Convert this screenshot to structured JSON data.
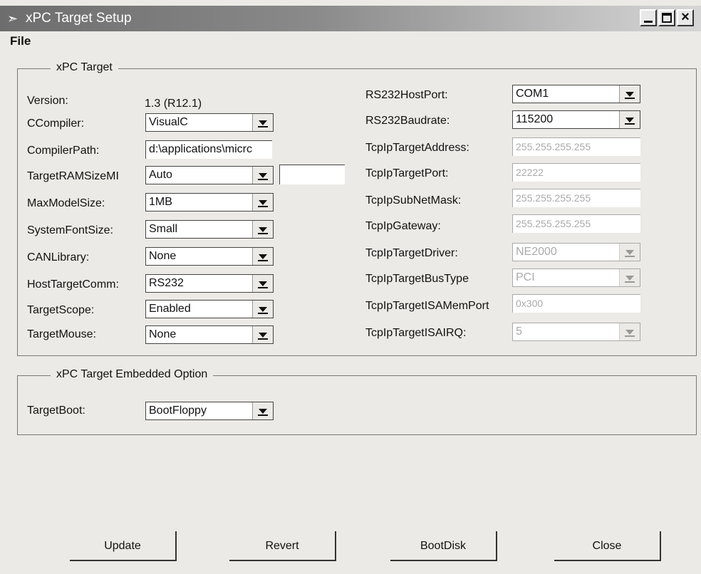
{
  "window": {
    "title": "xPC Target Setup",
    "icon": "matlab-icon"
  },
  "menu": {
    "file": "File"
  },
  "xpc_target": {
    "legend": "xPC Target",
    "version_label": "Version:",
    "version_value": "1.3 (R12.1)",
    "ccompiler_label": "CCompiler:",
    "ccompiler_value": "VisualC",
    "compilerpath_label": "CompilerPath:",
    "compilerpath_value": "d:\\applications\\micrc",
    "ramsize_label": "TargetRAMSizeMI",
    "ramsize_value": "Auto",
    "ramsize_extra_value": "",
    "maxmodelsize_label": "MaxModelSize:",
    "maxmodelsize_value": "1MB",
    "systemfontsize_label": "SystemFontSize:",
    "systemfontsize_value": "Small",
    "canlibrary_label": "CANLibrary:",
    "canlibrary_value": "None",
    "hosttargetcomm_label": "HostTargetComm:",
    "hosttargetcomm_value": "RS232",
    "targetscope_label": "TargetScope:",
    "targetscope_value": "Enabled",
    "targetmouse_label": "TargetMouse:",
    "targetmouse_value": "None",
    "rs232hostport_label": "RS232HostPort:",
    "rs232hostport_value": "COM1",
    "rs232baudrate_label": "RS232Baudrate:",
    "rs232baudrate_value": "115200",
    "tcpip_target_address_label": "TcpIpTargetAddress:",
    "tcpip_target_address_value": "255.255.255.255",
    "tcpip_target_port_label": "TcpIpTargetPort:",
    "tcpip_target_port_value": "22222",
    "tcpip_subnet_mask_label": "TcpIpSubNetMask:",
    "tcpip_subnet_mask_value": "255.255.255.255",
    "tcpip_gateway_label": "TcpIpGateway:",
    "tcpip_gateway_value": "255.255.255.255",
    "tcpip_target_driver_label": "TcpIpTargetDriver:",
    "tcpip_target_driver_value": "NE2000",
    "tcpip_target_bus_type_label": "TcpIpTargetBusType",
    "tcpip_target_bus_type_value": "PCI",
    "tcpip_isa_mem_port_label": "TcpIpTargetISAMemPort",
    "tcpip_isa_mem_port_value": "0x300",
    "tcpip_isa_irq_label": "TcpIpTargetISAIRQ:",
    "tcpip_isa_irq_value": "5"
  },
  "embedded": {
    "legend": "xPC Target Embedded Option",
    "targetboot_label": "TargetBoot:",
    "targetboot_value": "BootFloppy"
  },
  "buttons": {
    "update": "Update",
    "revert": "Revert",
    "bootdisk": "BootDisk",
    "close": "Close"
  }
}
